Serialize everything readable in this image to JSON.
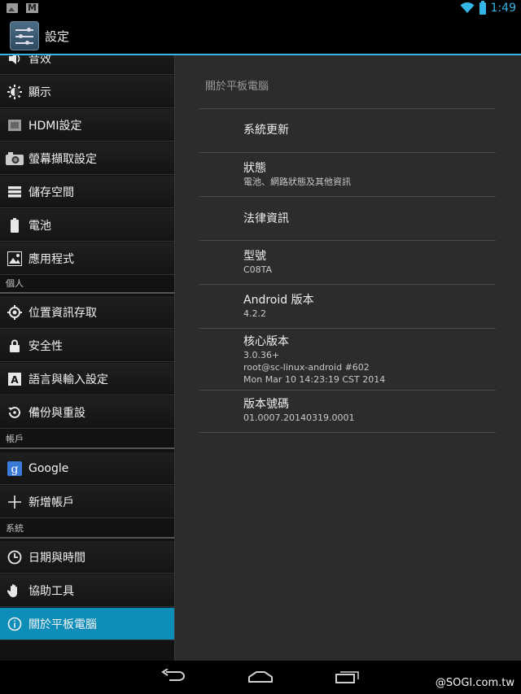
{
  "status_bar": {
    "time": "1:49",
    "icons": [
      "image-icon",
      "gmail-icon",
      "wifi-icon",
      "battery-icon"
    ],
    "accent": "#33b5e5"
  },
  "action_bar": {
    "title": "設定",
    "icon": "settings-icon"
  },
  "sidebar": {
    "items": [
      {
        "label": "音效",
        "icon": "speaker-icon"
      },
      {
        "label": "顯示",
        "icon": "brightness-icon"
      },
      {
        "label": "HDMI設定",
        "icon": "hdmi-icon"
      },
      {
        "label": "螢幕擷取設定",
        "icon": "camera-icon"
      },
      {
        "label": "儲存空間",
        "icon": "storage-icon"
      },
      {
        "label": "電池",
        "icon": "battery-icon"
      },
      {
        "label": "應用程式",
        "icon": "apps-icon"
      }
    ],
    "personal_header": "個人",
    "personal": [
      {
        "label": "位置資訊存取",
        "icon": "location-icon"
      },
      {
        "label": "安全性",
        "icon": "lock-icon"
      },
      {
        "label": "語言與輸入設定",
        "icon": "keyboard-icon"
      },
      {
        "label": "備份與重設",
        "icon": "backup-icon"
      }
    ],
    "accounts_header": "帳戶",
    "accounts": [
      {
        "label": "Google",
        "icon": "google-icon"
      },
      {
        "label": "新增帳戶",
        "icon": "plus-icon"
      }
    ],
    "system_header": "系統",
    "system": [
      {
        "label": "日期與時間",
        "icon": "clock-icon"
      },
      {
        "label": "協助工具",
        "icon": "hand-icon"
      },
      {
        "label": "關於平板電腦",
        "icon": "info-icon",
        "selected": true
      }
    ],
    "selected_color": "#0f8db9"
  },
  "about": {
    "title": "關於平板電腦",
    "items": [
      {
        "title": "系統更新"
      },
      {
        "title": "狀態",
        "summary": "電池、網路狀態及其他資訊"
      },
      {
        "title": "法律資訊"
      },
      {
        "title": "型號",
        "summary": "C08TA"
      },
      {
        "title": "Android 版本",
        "summary": "4.2.2"
      },
      {
        "title": "核心版本",
        "lines": [
          "3.0.36+",
          "root@sc-linux-android #602",
          "Mon Mar 10 14:23:19 CST 2014"
        ]
      },
      {
        "title": "版本號碼",
        "summary": "01.0007.20140319.0001"
      }
    ]
  },
  "nav_bar": {
    "buttons": [
      "back-icon",
      "home-icon",
      "recent-apps-icon"
    ]
  },
  "watermark": "@SOGI.com.tw"
}
